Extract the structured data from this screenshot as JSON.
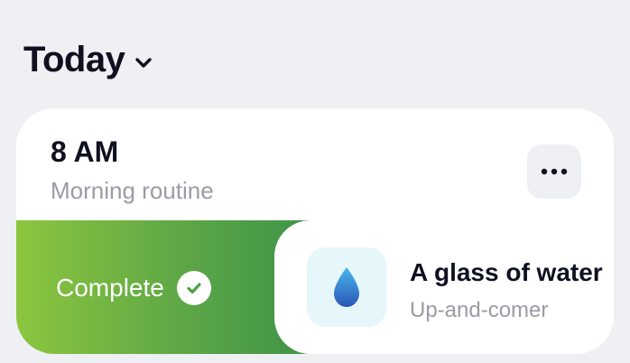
{
  "header": {
    "title": "Today",
    "dropdown_icon": "chevron-down-icon"
  },
  "routine_card": {
    "time": "8 AM",
    "name": "Morning routine",
    "more_icon": "more-horizontal-icon",
    "swipe_action": {
      "label": "Complete",
      "icon": "check-circle-icon"
    },
    "habit": {
      "title": "A glass of water",
      "subtitle": "Up-and-comer",
      "icon": "water-drop-icon"
    }
  }
}
